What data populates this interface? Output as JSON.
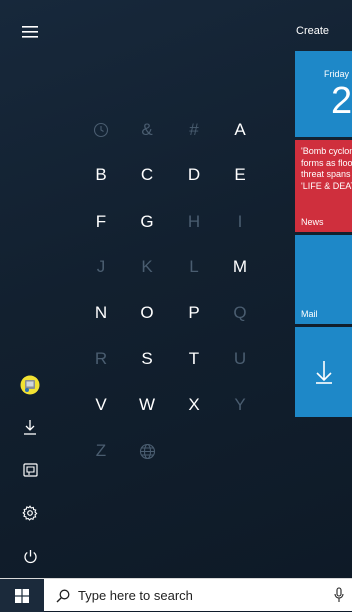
{
  "rail": {
    "items": [
      {
        "name": "hamburger-menu-icon"
      },
      {
        "name": "user-avatar-icon"
      },
      {
        "name": "downloads-icon"
      },
      {
        "name": "documents-icon"
      },
      {
        "name": "settings-icon"
      },
      {
        "name": "power-icon"
      }
    ]
  },
  "grid": {
    "rows": [
      [
        {
          "t": "clock-icon",
          "dim": true
        },
        {
          "t": "&",
          "dim": true
        },
        {
          "t": "#",
          "dim": true
        },
        {
          "t": "A",
          "dim": false
        }
      ],
      [
        {
          "t": "B",
          "dim": false
        },
        {
          "t": "C",
          "dim": false
        },
        {
          "t": "D",
          "dim": false
        },
        {
          "t": "E",
          "dim": false
        }
      ],
      [
        {
          "t": "F",
          "dim": false
        },
        {
          "t": "G",
          "dim": false
        },
        {
          "t": "H",
          "dim": true
        },
        {
          "t": "I",
          "dim": true
        }
      ],
      [
        {
          "t": "J",
          "dim": true
        },
        {
          "t": "K",
          "dim": true
        },
        {
          "t": "L",
          "dim": true
        },
        {
          "t": "M",
          "dim": false
        }
      ],
      [
        {
          "t": "N",
          "dim": false
        },
        {
          "t": "O",
          "dim": false
        },
        {
          "t": "P",
          "dim": false
        },
        {
          "t": "Q",
          "dim": true
        }
      ],
      [
        {
          "t": "R",
          "dim": true
        },
        {
          "t": "S",
          "dim": false
        },
        {
          "t": "T",
          "dim": false
        },
        {
          "t": "U",
          "dim": true
        }
      ],
      [
        {
          "t": "V",
          "dim": false
        },
        {
          "t": "W",
          "dim": false
        },
        {
          "t": "X",
          "dim": false
        },
        {
          "t": "Y",
          "dim": true
        }
      ],
      [
        {
          "t": "Z",
          "dim": true
        },
        {
          "t": "globe-icon",
          "dim": true
        }
      ]
    ]
  },
  "tiles": {
    "header": "Create",
    "calendar": {
      "day": "Friday",
      "date": "2"
    },
    "news": {
      "lines": [
        "'Bomb cyclone'",
        "forms as flood",
        "threat spans",
        "'LIFE & DEATH'"
      ],
      "label": "News"
    },
    "mail": {
      "label": "Mail"
    },
    "download": {
      "icon": "download-arrow-icon"
    }
  },
  "taskbar": {
    "start_icon": "windows-logo-icon",
    "search_icon": "search-icon",
    "search_placeholder": "Type here to search",
    "mic_icon": "microphone-icon"
  },
  "colors": {
    "tile_blue": "#1e88c8",
    "tile_red": "#cf2f3d",
    "start_bg": "#12202f",
    "dim_letter": "#4a5d70"
  }
}
